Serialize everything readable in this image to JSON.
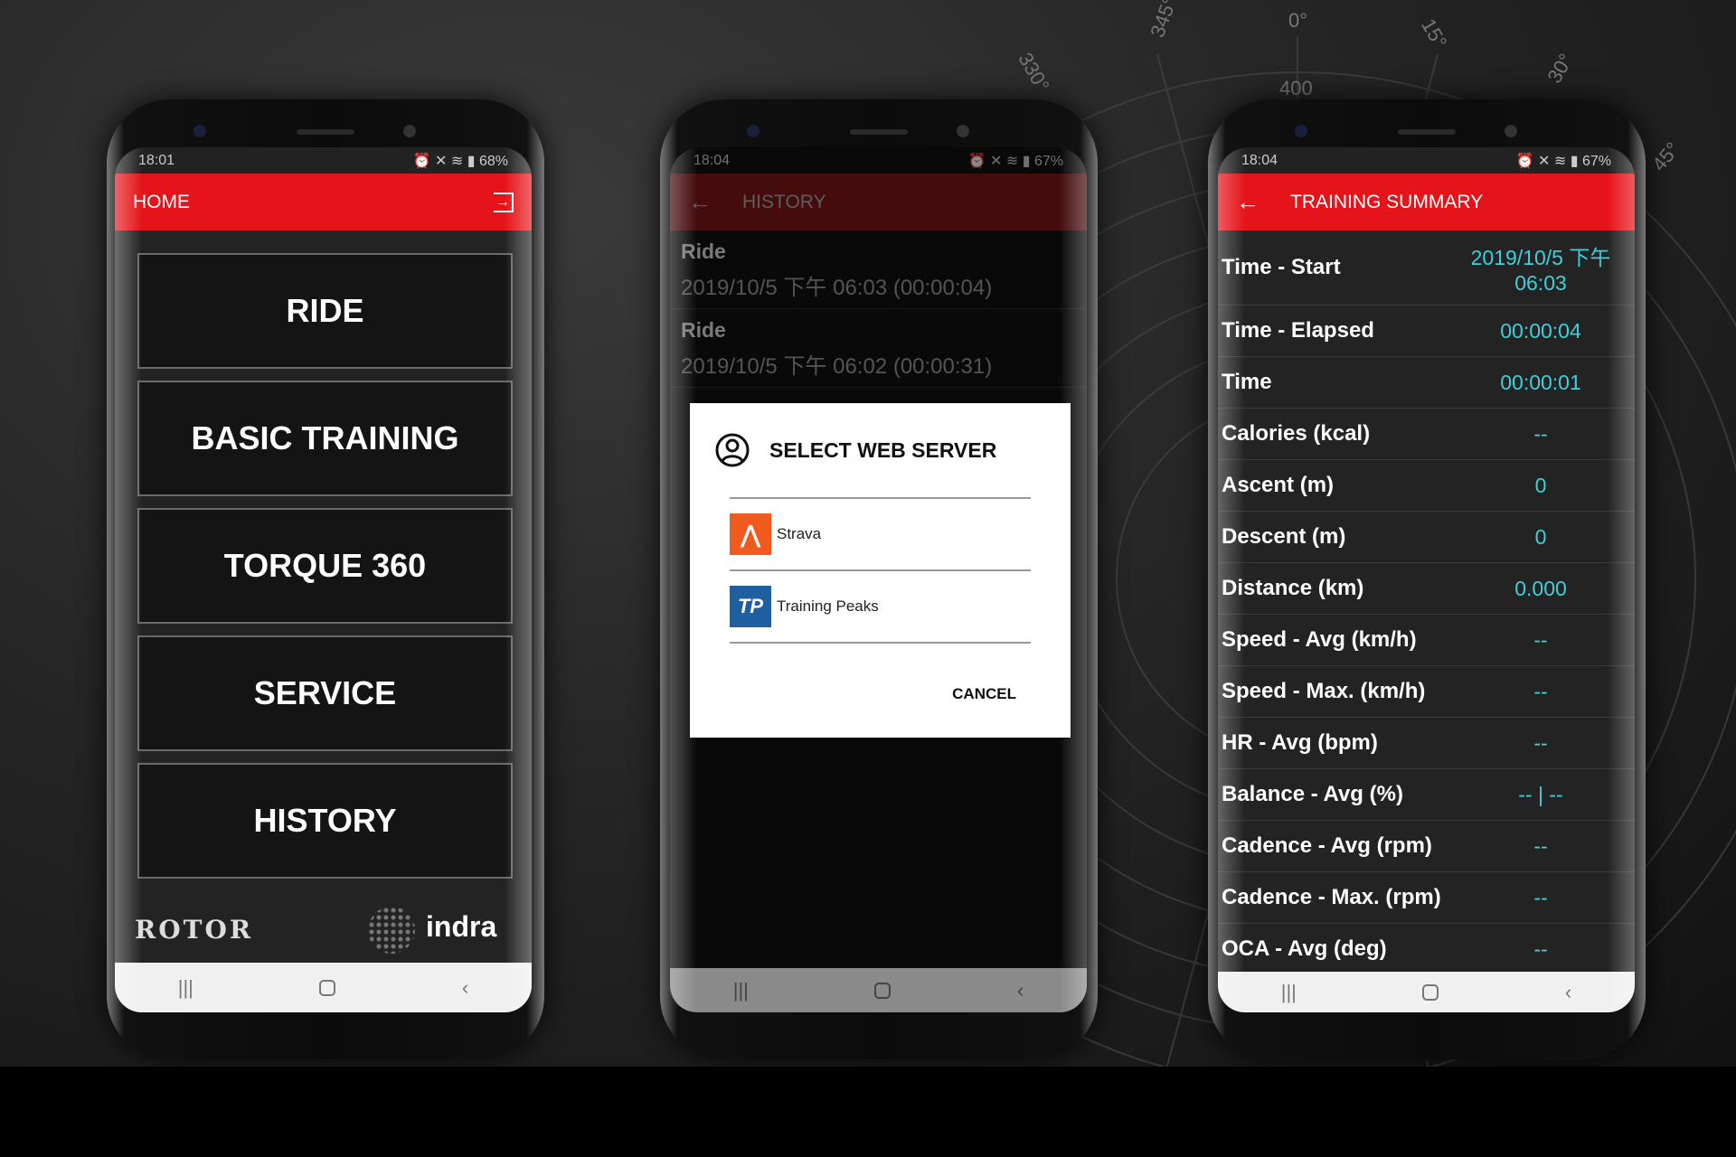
{
  "colors": {
    "accent": "#e5141a",
    "value": "#3ed0da",
    "strava": "#f05a1e",
    "trainingpeaks": "#1f5fa0"
  },
  "background": {
    "compass_labels": [
      "345°",
      "0°",
      "15°",
      "330°",
      "30°",
      "45°"
    ],
    "ring_label": "400"
  },
  "home": {
    "status": {
      "time": "18:01",
      "battery": "68%"
    },
    "title": "HOME",
    "exit_icon": "exit-icon",
    "menu": [
      "RIDE",
      "BASIC TRAINING",
      "TORQUE 360",
      "SERVICE",
      "HISTORY"
    ],
    "logos": {
      "rotor": "ROTOR",
      "indra": "indra"
    }
  },
  "history": {
    "status": {
      "time": "18:04",
      "battery": "67%"
    },
    "title": "HISTORY",
    "rows": [
      {
        "type": "Ride",
        "detail": "2019/10/5 下午 06:03 (00:00:04)"
      },
      {
        "type": "Ride",
        "detail": "2019/10/5 下午 06:02 (00:00:31)"
      }
    ],
    "dialog": {
      "title": "SELECT WEB SERVER",
      "options": [
        {
          "label": "Strava",
          "icon": "strava-icon"
        },
        {
          "label": "Training Peaks",
          "icon": "training-peaks-icon",
          "badge": "TP"
        }
      ],
      "cancel": "CANCEL"
    }
  },
  "summary": {
    "status": {
      "time": "18:04",
      "battery": "67%"
    },
    "title": "TRAINING SUMMARY",
    "rows": [
      {
        "label": "Time - Start",
        "value": "2019/10/5 下午 06:03"
      },
      {
        "label": "Time - Elapsed",
        "value": "00:00:04"
      },
      {
        "label": "Time",
        "value": "00:00:01"
      },
      {
        "label": "Calories (kcal)",
        "value": "--"
      },
      {
        "label": "Ascent (m)",
        "value": "0"
      },
      {
        "label": "Descent (m)",
        "value": "0"
      },
      {
        "label": "Distance (km)",
        "value": "0.000"
      },
      {
        "label": "Speed - Avg (km/h)",
        "value": "--"
      },
      {
        "label": "Speed - Max. (km/h)",
        "value": "--"
      },
      {
        "label": "HR - Avg (bpm)",
        "value": "--"
      },
      {
        "label": "Balance - Avg (%)",
        "value": "-- | --"
      },
      {
        "label": "Cadence - Avg (rpm)",
        "value": "--"
      },
      {
        "label": "Cadence - Max. (rpm)",
        "value": "--"
      },
      {
        "label": "OCA - Avg (deg)",
        "value": "--"
      }
    ]
  }
}
